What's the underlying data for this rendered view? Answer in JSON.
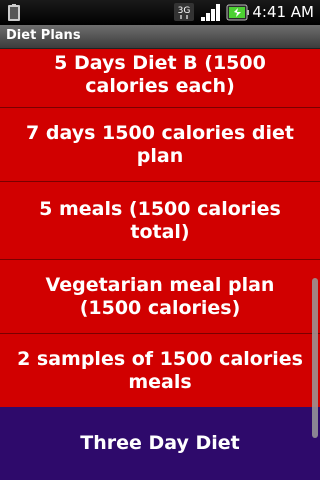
{
  "status_bar": {
    "time": "4:41 AM",
    "network_label": "3G",
    "icons": [
      "sim-card-icon",
      "network-3g-icon",
      "signal-icon",
      "battery-icon"
    ]
  },
  "app": {
    "title": "Diet Plans"
  },
  "list": {
    "items": [
      {
        "label": "5 Days Diet B (1500 calories each)",
        "color": "#d10000"
      },
      {
        "label": "7 days 1500 calories diet plan",
        "color": "#d10000"
      },
      {
        "label": "5 meals (1500 calories total)",
        "color": "#d10000"
      },
      {
        "label": "Vegetarian meal plan (1500 calories)",
        "color": "#d10000"
      },
      {
        "label": "2 samples of 1500 calories meals",
        "color": "#d10000"
      },
      {
        "label": "Three Day Diet",
        "color": "#2e0a6b"
      }
    ]
  }
}
